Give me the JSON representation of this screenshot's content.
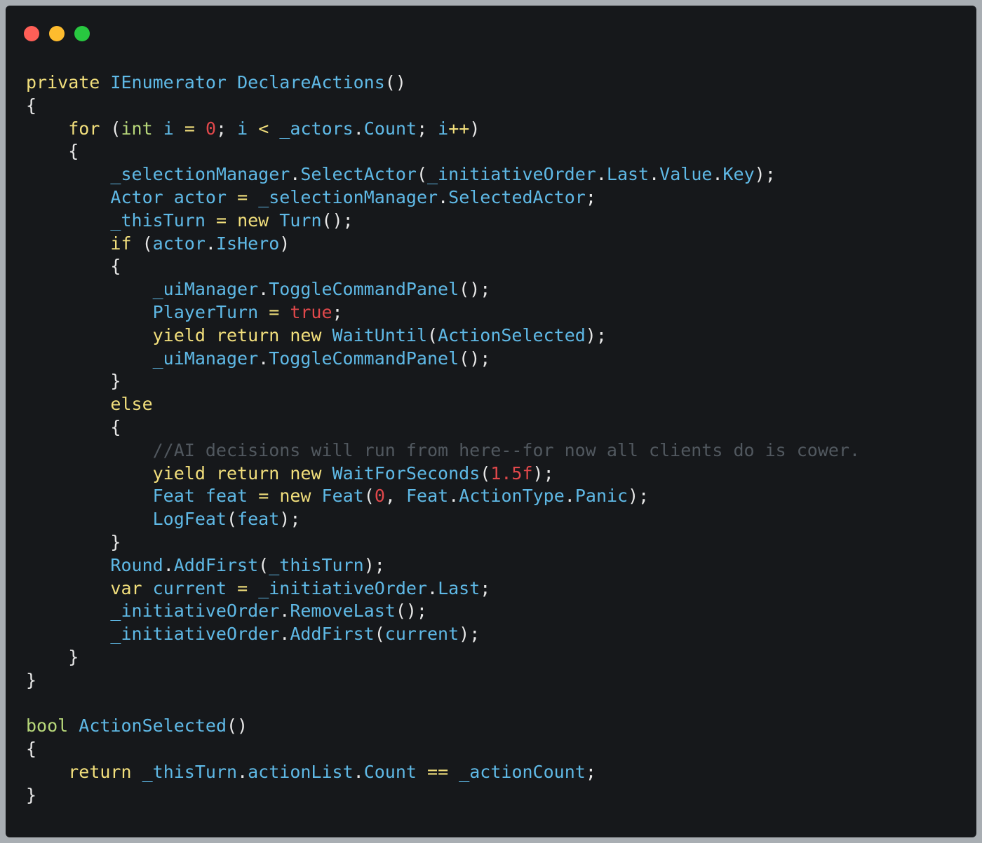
{
  "window": {
    "controls": [
      {
        "name": "close",
        "color": "#ff5f57"
      },
      {
        "name": "minimize",
        "color": "#febc2e"
      },
      {
        "name": "maximize",
        "color": "#28c840"
      }
    ]
  },
  "colors": {
    "background": "#16181b",
    "keyword": "#f2df7c",
    "type": "#b7d77a",
    "identifier": "#5fb9e6",
    "number": "#e0484b",
    "comment": "#51585f",
    "punctuation": "#e8e8e8"
  },
  "code": {
    "language": "C#",
    "lines": [
      [
        [
          "kw",
          "private"
        ],
        [
          "pn",
          " "
        ],
        [
          "id",
          "IEnumerator"
        ],
        [
          "pn",
          " "
        ],
        [
          "id",
          "DeclareActions"
        ],
        [
          "pn",
          "()"
        ]
      ],
      [
        [
          "pn",
          "{"
        ]
      ],
      [
        [
          "pn",
          "    "
        ],
        [
          "kw",
          "for"
        ],
        [
          "pn",
          " ("
        ],
        [
          "ty",
          "int"
        ],
        [
          "pn",
          " "
        ],
        [
          "id",
          "i"
        ],
        [
          "pn",
          " "
        ],
        [
          "op",
          "="
        ],
        [
          "pn",
          " "
        ],
        [
          "num",
          "0"
        ],
        [
          "pn",
          "; "
        ],
        [
          "id",
          "i"
        ],
        [
          "pn",
          " "
        ],
        [
          "op",
          "<"
        ],
        [
          "pn",
          " "
        ],
        [
          "id",
          "_actors"
        ],
        [
          "pn",
          "."
        ],
        [
          "id",
          "Count"
        ],
        [
          "pn",
          "; "
        ],
        [
          "id",
          "i"
        ],
        [
          "op",
          "++"
        ],
        [
          "pn",
          ")"
        ]
      ],
      [
        [
          "pn",
          "    {"
        ]
      ],
      [
        [
          "pn",
          "        "
        ],
        [
          "id",
          "_selectionManager"
        ],
        [
          "pn",
          "."
        ],
        [
          "id",
          "SelectActor"
        ],
        [
          "pn",
          "("
        ],
        [
          "id",
          "_initiativeOrder"
        ],
        [
          "pn",
          "."
        ],
        [
          "id",
          "Last"
        ],
        [
          "pn",
          "."
        ],
        [
          "id",
          "Value"
        ],
        [
          "pn",
          "."
        ],
        [
          "id",
          "Key"
        ],
        [
          "pn",
          ");"
        ]
      ],
      [
        [
          "pn",
          "        "
        ],
        [
          "id",
          "Actor"
        ],
        [
          "pn",
          " "
        ],
        [
          "id",
          "actor"
        ],
        [
          "pn",
          " "
        ],
        [
          "op",
          "="
        ],
        [
          "pn",
          " "
        ],
        [
          "id",
          "_selectionManager"
        ],
        [
          "pn",
          "."
        ],
        [
          "id",
          "SelectedActor"
        ],
        [
          "pn",
          ";"
        ]
      ],
      [
        [
          "pn",
          "        "
        ],
        [
          "id",
          "_thisTurn"
        ],
        [
          "pn",
          " "
        ],
        [
          "op",
          "="
        ],
        [
          "pn",
          " "
        ],
        [
          "kw",
          "new"
        ],
        [
          "pn",
          " "
        ],
        [
          "id",
          "Turn"
        ],
        [
          "pn",
          "();"
        ]
      ],
      [
        [
          "pn",
          "        "
        ],
        [
          "kw",
          "if"
        ],
        [
          "pn",
          " ("
        ],
        [
          "id",
          "actor"
        ],
        [
          "pn",
          "."
        ],
        [
          "id",
          "IsHero"
        ],
        [
          "pn",
          ")"
        ]
      ],
      [
        [
          "pn",
          "        {"
        ]
      ],
      [
        [
          "pn",
          "            "
        ],
        [
          "id",
          "_uiManager"
        ],
        [
          "pn",
          "."
        ],
        [
          "id",
          "ToggleCommandPanel"
        ],
        [
          "pn",
          "();"
        ]
      ],
      [
        [
          "pn",
          "            "
        ],
        [
          "id",
          "PlayerTurn"
        ],
        [
          "pn",
          " "
        ],
        [
          "op",
          "="
        ],
        [
          "pn",
          " "
        ],
        [
          "num",
          "true"
        ],
        [
          "pn",
          ";"
        ]
      ],
      [
        [
          "pn",
          "            "
        ],
        [
          "kw",
          "yield"
        ],
        [
          "pn",
          " "
        ],
        [
          "kw",
          "return"
        ],
        [
          "pn",
          " "
        ],
        [
          "kw",
          "new"
        ],
        [
          "pn",
          " "
        ],
        [
          "id",
          "WaitUntil"
        ],
        [
          "pn",
          "("
        ],
        [
          "id",
          "ActionSelected"
        ],
        [
          "pn",
          ");"
        ]
      ],
      [
        [
          "pn",
          "            "
        ],
        [
          "id",
          "_uiManager"
        ],
        [
          "pn",
          "."
        ],
        [
          "id",
          "ToggleCommandPanel"
        ],
        [
          "pn",
          "();"
        ]
      ],
      [
        [
          "pn",
          "        }"
        ]
      ],
      [
        [
          "pn",
          "        "
        ],
        [
          "kw",
          "else"
        ]
      ],
      [
        [
          "pn",
          "        {"
        ]
      ],
      [
        [
          "pn",
          "            "
        ],
        [
          "cm",
          "//AI decisions will run from here--for now all clients do is cower."
        ]
      ],
      [
        [
          "pn",
          "            "
        ],
        [
          "kw",
          "yield"
        ],
        [
          "pn",
          " "
        ],
        [
          "kw",
          "return"
        ],
        [
          "pn",
          " "
        ],
        [
          "kw",
          "new"
        ],
        [
          "pn",
          " "
        ],
        [
          "id",
          "WaitForSeconds"
        ],
        [
          "pn",
          "("
        ],
        [
          "num",
          "1.5f"
        ],
        [
          "pn",
          ");"
        ]
      ],
      [
        [
          "pn",
          "            "
        ],
        [
          "id",
          "Feat"
        ],
        [
          "pn",
          " "
        ],
        [
          "id",
          "feat"
        ],
        [
          "pn",
          " "
        ],
        [
          "op",
          "="
        ],
        [
          "pn",
          " "
        ],
        [
          "kw",
          "new"
        ],
        [
          "pn",
          " "
        ],
        [
          "id",
          "Feat"
        ],
        [
          "pn",
          "("
        ],
        [
          "num",
          "0"
        ],
        [
          "pn",
          ", "
        ],
        [
          "id",
          "Feat"
        ],
        [
          "pn",
          "."
        ],
        [
          "id",
          "ActionType"
        ],
        [
          "pn",
          "."
        ],
        [
          "id",
          "Panic"
        ],
        [
          "pn",
          ");"
        ]
      ],
      [
        [
          "pn",
          "            "
        ],
        [
          "id",
          "LogFeat"
        ],
        [
          "pn",
          "("
        ],
        [
          "id",
          "feat"
        ],
        [
          "pn",
          ");"
        ]
      ],
      [
        [
          "pn",
          "        }"
        ]
      ],
      [
        [
          "pn",
          "        "
        ],
        [
          "id",
          "Round"
        ],
        [
          "pn",
          "."
        ],
        [
          "id",
          "AddFirst"
        ],
        [
          "pn",
          "("
        ],
        [
          "id",
          "_thisTurn"
        ],
        [
          "pn",
          ");"
        ]
      ],
      [
        [
          "pn",
          "        "
        ],
        [
          "kw",
          "var"
        ],
        [
          "pn",
          " "
        ],
        [
          "id",
          "current"
        ],
        [
          "pn",
          " "
        ],
        [
          "op",
          "="
        ],
        [
          "pn",
          " "
        ],
        [
          "id",
          "_initiativeOrder"
        ],
        [
          "pn",
          "."
        ],
        [
          "id",
          "Last"
        ],
        [
          "pn",
          ";"
        ]
      ],
      [
        [
          "pn",
          "        "
        ],
        [
          "id",
          "_initiativeOrder"
        ],
        [
          "pn",
          "."
        ],
        [
          "id",
          "RemoveLast"
        ],
        [
          "pn",
          "();"
        ]
      ],
      [
        [
          "pn",
          "        "
        ],
        [
          "id",
          "_initiativeOrder"
        ],
        [
          "pn",
          "."
        ],
        [
          "id",
          "AddFirst"
        ],
        [
          "pn",
          "("
        ],
        [
          "id",
          "current"
        ],
        [
          "pn",
          ");"
        ]
      ],
      [
        [
          "pn",
          "    }"
        ]
      ],
      [
        [
          "pn",
          "}"
        ]
      ],
      [],
      [
        [
          "ty",
          "bool"
        ],
        [
          "pn",
          " "
        ],
        [
          "id",
          "ActionSelected"
        ],
        [
          "pn",
          "()"
        ]
      ],
      [
        [
          "pn",
          "{"
        ]
      ],
      [
        [
          "pn",
          "    "
        ],
        [
          "kw",
          "return"
        ],
        [
          "pn",
          " "
        ],
        [
          "id",
          "_thisTurn"
        ],
        [
          "pn",
          "."
        ],
        [
          "id",
          "actionList"
        ],
        [
          "pn",
          "."
        ],
        [
          "id",
          "Count"
        ],
        [
          "pn",
          " "
        ],
        [
          "op",
          "=="
        ],
        [
          "pn",
          " "
        ],
        [
          "id",
          "_actionCount"
        ],
        [
          "pn",
          ";"
        ]
      ],
      [
        [
          "pn",
          "}"
        ]
      ]
    ]
  }
}
